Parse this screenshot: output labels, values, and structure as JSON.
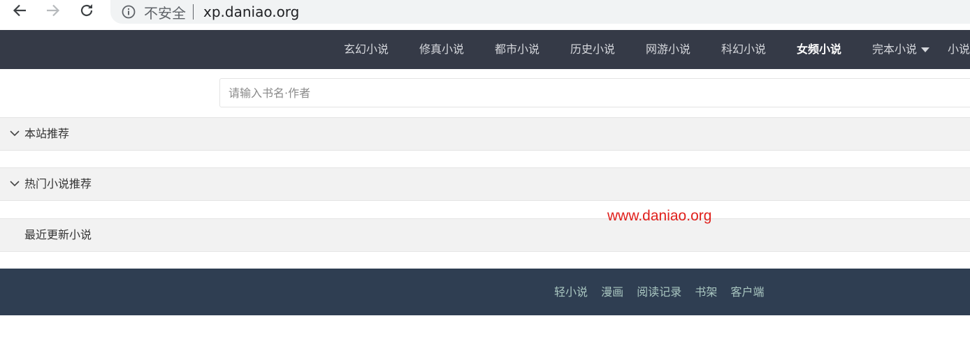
{
  "browser": {
    "security_label": "不安全",
    "url": "xp.daniao.org"
  },
  "nav": {
    "items": [
      {
        "label": "玄幻小说",
        "active": false
      },
      {
        "label": "修真小说",
        "active": false
      },
      {
        "label": "都市小说",
        "active": false
      },
      {
        "label": "历史小说",
        "active": false
      },
      {
        "label": "网游小说",
        "active": false
      },
      {
        "label": "科幻小说",
        "active": false
      },
      {
        "label": "女频小说",
        "active": true
      },
      {
        "label": "完本小说",
        "active": false,
        "has_dropdown": true
      },
      {
        "label": "小说",
        "active": false
      }
    ]
  },
  "search": {
    "placeholder": "请输入书名·作者",
    "value": ""
  },
  "sections": {
    "recommended": {
      "title": "本站推荐"
    },
    "hot": {
      "title": "热门小说推荐"
    },
    "latest": {
      "title": "最近更新小说"
    }
  },
  "watermark": "www.daniao.org",
  "footer": {
    "links": [
      "轻小说",
      "漫画",
      "阅读记录",
      "书架",
      "客户端"
    ]
  },
  "colors": {
    "nav_bg": "#353a47",
    "footer_bg": "#2f3e52",
    "footer_link": "#a9c6c0",
    "watermark": "#e0201c"
  }
}
